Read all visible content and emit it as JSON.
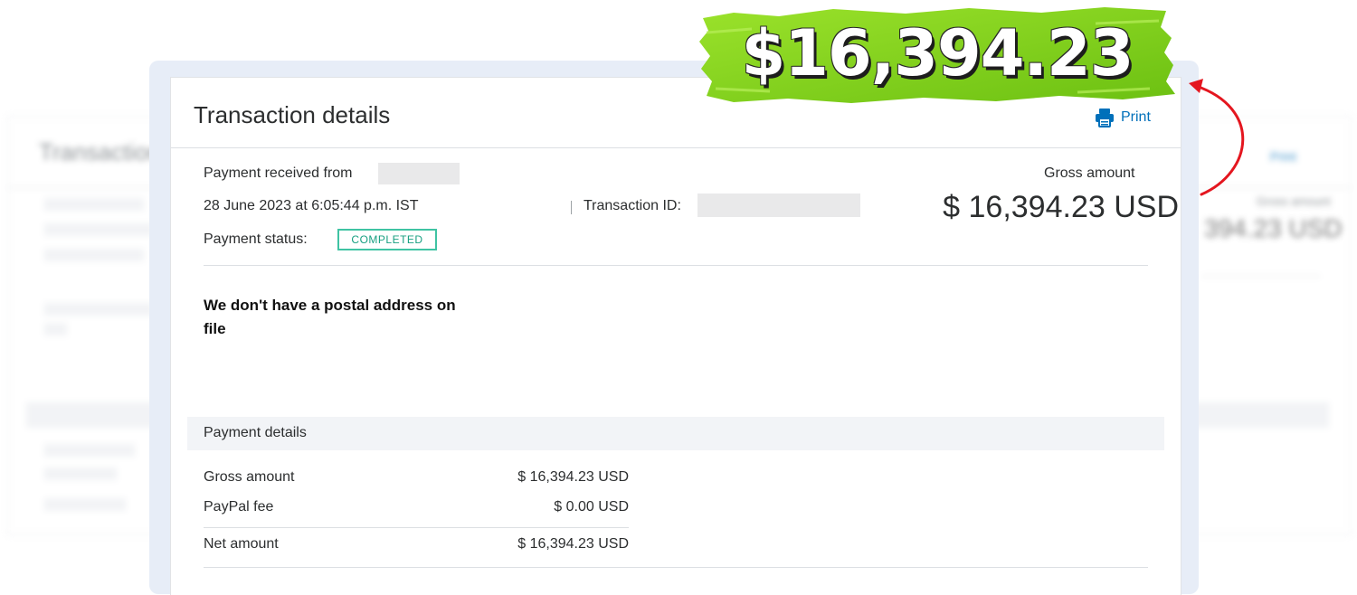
{
  "banner": {
    "amount": "$16,394.23",
    "accent": "#7fd319"
  },
  "background_card": {
    "labels": [
      "Transaction",
      "Print",
      "Gross amount",
      "394.23 USD"
    ]
  },
  "card": {
    "title": "Transaction details",
    "print_label": "Print",
    "print_icon": "printer-icon",
    "payment_received_from_label": "Payment received from",
    "date": "28 June 2023 at 6:05:44 p.m. IST",
    "transaction_id_label": "Transaction ID:",
    "payment_status_label": "Payment status:",
    "payment_status_value": "COMPLETED",
    "gross_amount_label": "Gross amount",
    "gross_amount_value": "$ 16,394.23 USD",
    "postal_note": "We don't have a postal address on file"
  },
  "payment_details": {
    "heading": "Payment details",
    "rows": [
      {
        "label": "Gross amount",
        "value": "$ 16,394.23 USD"
      },
      {
        "label": "PayPal fee",
        "value": "$ 0.00 USD"
      },
      {
        "label": "Net amount",
        "value": "$ 16,394.23 USD"
      }
    ]
  },
  "colors": {
    "link": "#0070ba",
    "status": "#3fc3a3",
    "arrow": "#e4161f"
  }
}
